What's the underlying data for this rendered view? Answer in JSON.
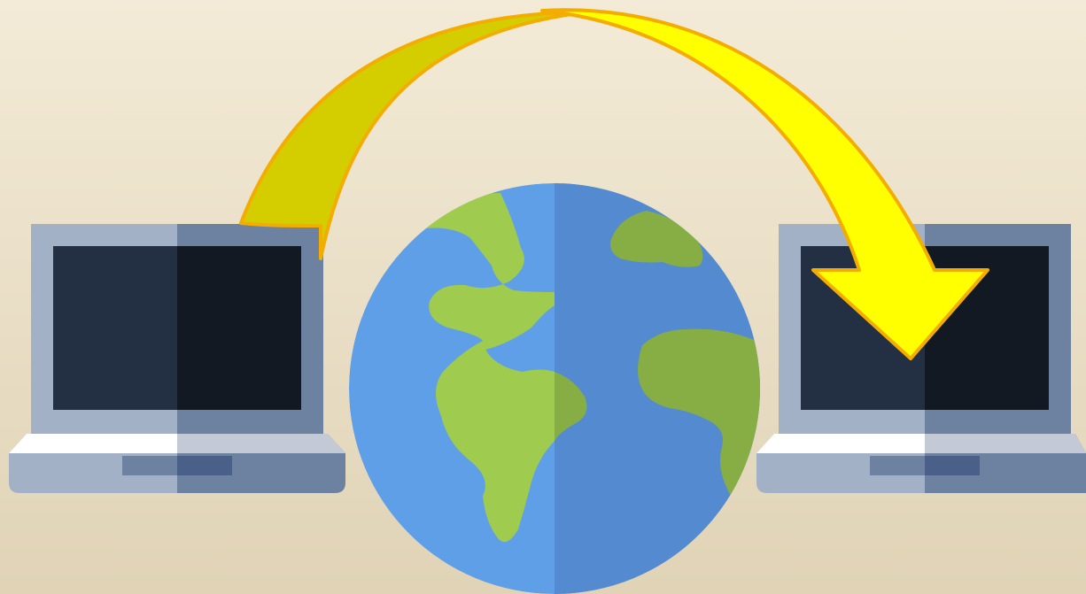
{
  "diagram": {
    "icons": [
      {
        "id": "source-laptop",
        "name": "laptop-icon"
      },
      {
        "id": "globe",
        "name": "globe-icon"
      },
      {
        "id": "destination-laptop",
        "name": "laptop-icon"
      }
    ],
    "arrow": {
      "from": "source-laptop",
      "to": "destination-laptop",
      "name": "transfer-arrow-icon"
    }
  },
  "colors": {
    "background_top": "#f3ebd7",
    "background_bottom": "#e0d3b6",
    "laptop_frame_light": "#a3b1c6",
    "laptop_frame_dark": "#6d81a1",
    "laptop_screen_light": "#233043",
    "laptop_screen_dark": "#131923",
    "laptop_base_top": "#ffffff",
    "laptop_base_top_dark": "#c3cad6",
    "laptop_trackpad_light": "#6d81a1",
    "laptop_trackpad_dark": "#4a6088",
    "globe_ocean_light": "#5f9fe8",
    "globe_ocean_dark": "#538ad0",
    "globe_land_light": "#9fcb4e",
    "globe_land_dark": "#87ae44",
    "arrow_fill_light": "#d4ce00",
    "arrow_fill_bright": "#ffff00",
    "arrow_outline": "#f3ad00"
  }
}
